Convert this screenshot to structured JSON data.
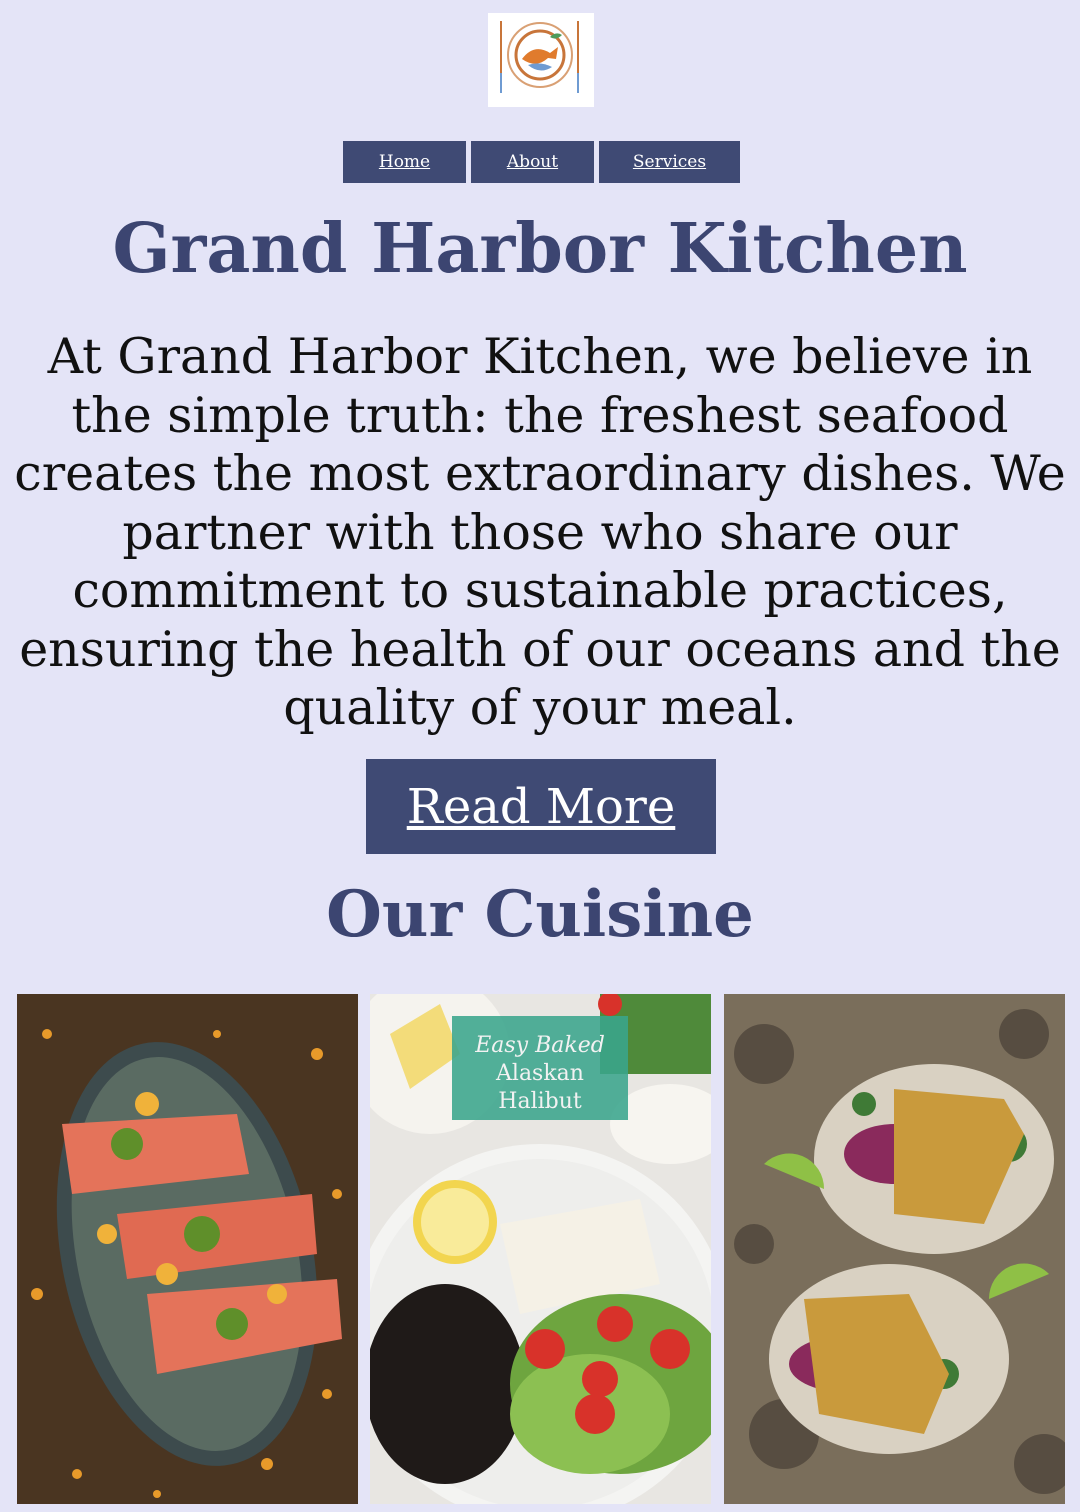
{
  "logo": {
    "icon": "fish-plate-logo-icon"
  },
  "nav": {
    "items": [
      "Home",
      "About",
      "Services"
    ]
  },
  "hero": {
    "title": "Grand Harbor Kitchen",
    "text": "At Grand Harbor Kitchen, we believe in the simple truth: the freshest seafood creates the most extraordinary dishes. We partner with those who share our commitment to sustainable practices, ensuring the health of our oceans and the quality of your meal.",
    "button": "Read More"
  },
  "cuisine": {
    "heading": "Our Cuisine",
    "photo2_caption": [
      "Easy Baked",
      "Alaskan",
      "Halibut"
    ]
  },
  "colors": {
    "background": "#e4e4f7",
    "primary": "#3f4a74",
    "heading": "#3c4571"
  }
}
